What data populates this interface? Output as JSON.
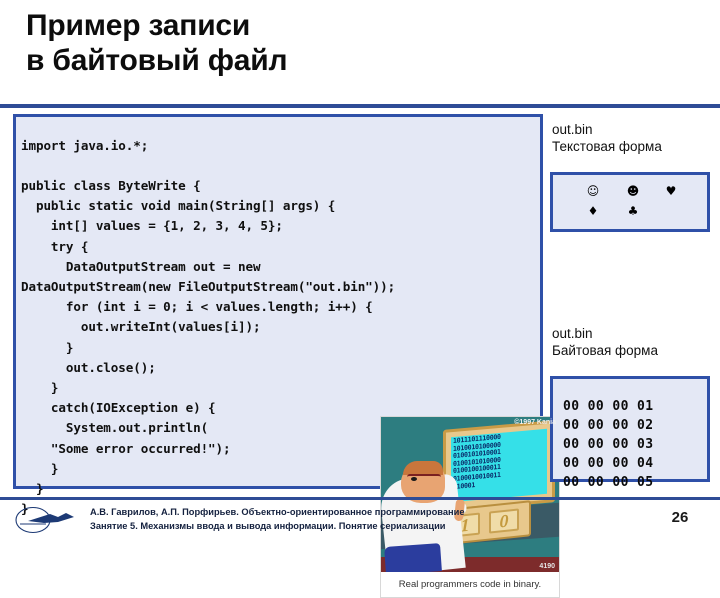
{
  "slide": {
    "title": "Пример записи\nв байтовый файл",
    "page_number": "26",
    "accent_color": "#2e4c96",
    "panel_border_color": "#2f50a8",
    "panel_fill_color": "#e4e8f5"
  },
  "code_panel": {
    "language": "java",
    "code": "import java.io.*;\n\npublic class ByteWrite {\n  public static void main(String[] args) {\n    int[] values = {1, 2, 3, 4, 5};\n    try {\n      DataOutputStream out = new\nDataOutputStream(new FileOutputStream(\"out.bin\"));\n      for (int i = 0; i < values.length; i++) {\n        out.writeInt(values[i]);\n      }\n      out.close();\n    }\n    catch(IOException e) {\n      System.out.println(\n    \"Some error occurred!\");\n    }\n  }\n}"
  },
  "cartoon": {
    "copyright": "©1997 Kania",
    "screen_binary": "1011101110000\n1010010100000\n0100101010001\n0100101010000\n0100100100011\n0100010010011\n010001",
    "key_left_label": "1",
    "key_right_label": "0",
    "corner_number": "4190",
    "caption": "Real programmers code in binary."
  },
  "text_form": {
    "label": "out.bin\nТекстовая форма",
    "rows": [
      [
        "☺",
        "☻",
        "♥"
      ],
      [
        "♦",
        "♣",
        ""
      ]
    ]
  },
  "byte_form": {
    "label": "out.bin\nБайтовая форма",
    "rows": "00 00 00 01\n00 00 00 02\n00 00 00 03\n00 00 00 04\n00 00 00 05"
  },
  "footer": {
    "text": "А.В. Гаврилов, А.П. Порфирьев. Объектно-ориентированное программирование\nЗанятие 5. Механизмы ввода и вывода информации. Понятие сериализации"
  }
}
